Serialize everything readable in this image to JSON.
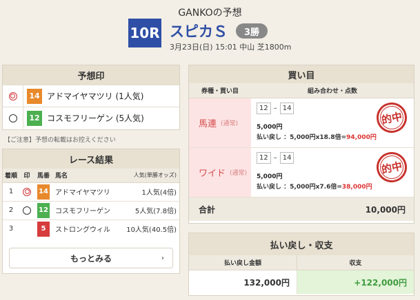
{
  "header": {
    "title": "GANKOの予想",
    "race_no": "10R",
    "race_name": "スピカＳ",
    "grade": "3勝",
    "info": "3月23日(日) 15:01 中山 芝1800m"
  },
  "prediction": {
    "heading": "予想印",
    "rows": [
      {
        "mark": "double-circle",
        "num": "14",
        "color": "#e8892b",
        "name": "アドマイヤマツリ (1人気)"
      },
      {
        "mark": "circle",
        "num": "12",
        "color": "#4caf50",
        "name": "コスモフリーゲン (5人気)"
      }
    ],
    "notice": "【ご注意】予想の転載はお控えください"
  },
  "results": {
    "heading": "レース結果",
    "columns": {
      "rank": "着順",
      "mark": "印",
      "num": "馬番",
      "horse": "馬名",
      "odds": "人気(単勝オッズ)"
    },
    "rows": [
      {
        "rank": "1",
        "mark": "double-circle",
        "num": "14",
        "color": "#e8892b",
        "horse": "アドマイヤマツリ",
        "odds": "1人気(4倍)"
      },
      {
        "rank": "2",
        "mark": "circle",
        "num": "12",
        "color": "#4caf50",
        "horse": "コスモフリーゲン",
        "odds": "5人気(7.8倍)"
      },
      {
        "rank": "3",
        "mark": "",
        "num": "5",
        "color": "#d63c3c",
        "horse": "ストロングウィル",
        "odds": "10人気(40.5倍)"
      }
    ],
    "more": "もっとみる"
  },
  "bets": {
    "heading": "買い目",
    "col_type": "券種・買い目",
    "col_combo": "組み合わせ・点数",
    "rows": [
      {
        "type": "馬連",
        "sub": "(通常)",
        "a": "12",
        "b": "14",
        "amount": "5,000円",
        "payout_label": "払い戻し ：5,000円x18.8倍=",
        "payout_value": "94,000円",
        "stamp": "的中"
      },
      {
        "type": "ワイド",
        "sub": "(通常)",
        "a": "12",
        "b": "14",
        "amount": "5,000円",
        "payout_label": "払い戻し ：5,000円x7.6倍=",
        "payout_value": "38,000円",
        "stamp": "的中"
      }
    ],
    "total_label": "合計",
    "total_value": "10,000円"
  },
  "balance": {
    "heading": "払い戻し・収支",
    "col_payout": "払い戻し金額",
    "col_balance": "収支",
    "payout": "132,000円",
    "balance": "+122,000円"
  }
}
